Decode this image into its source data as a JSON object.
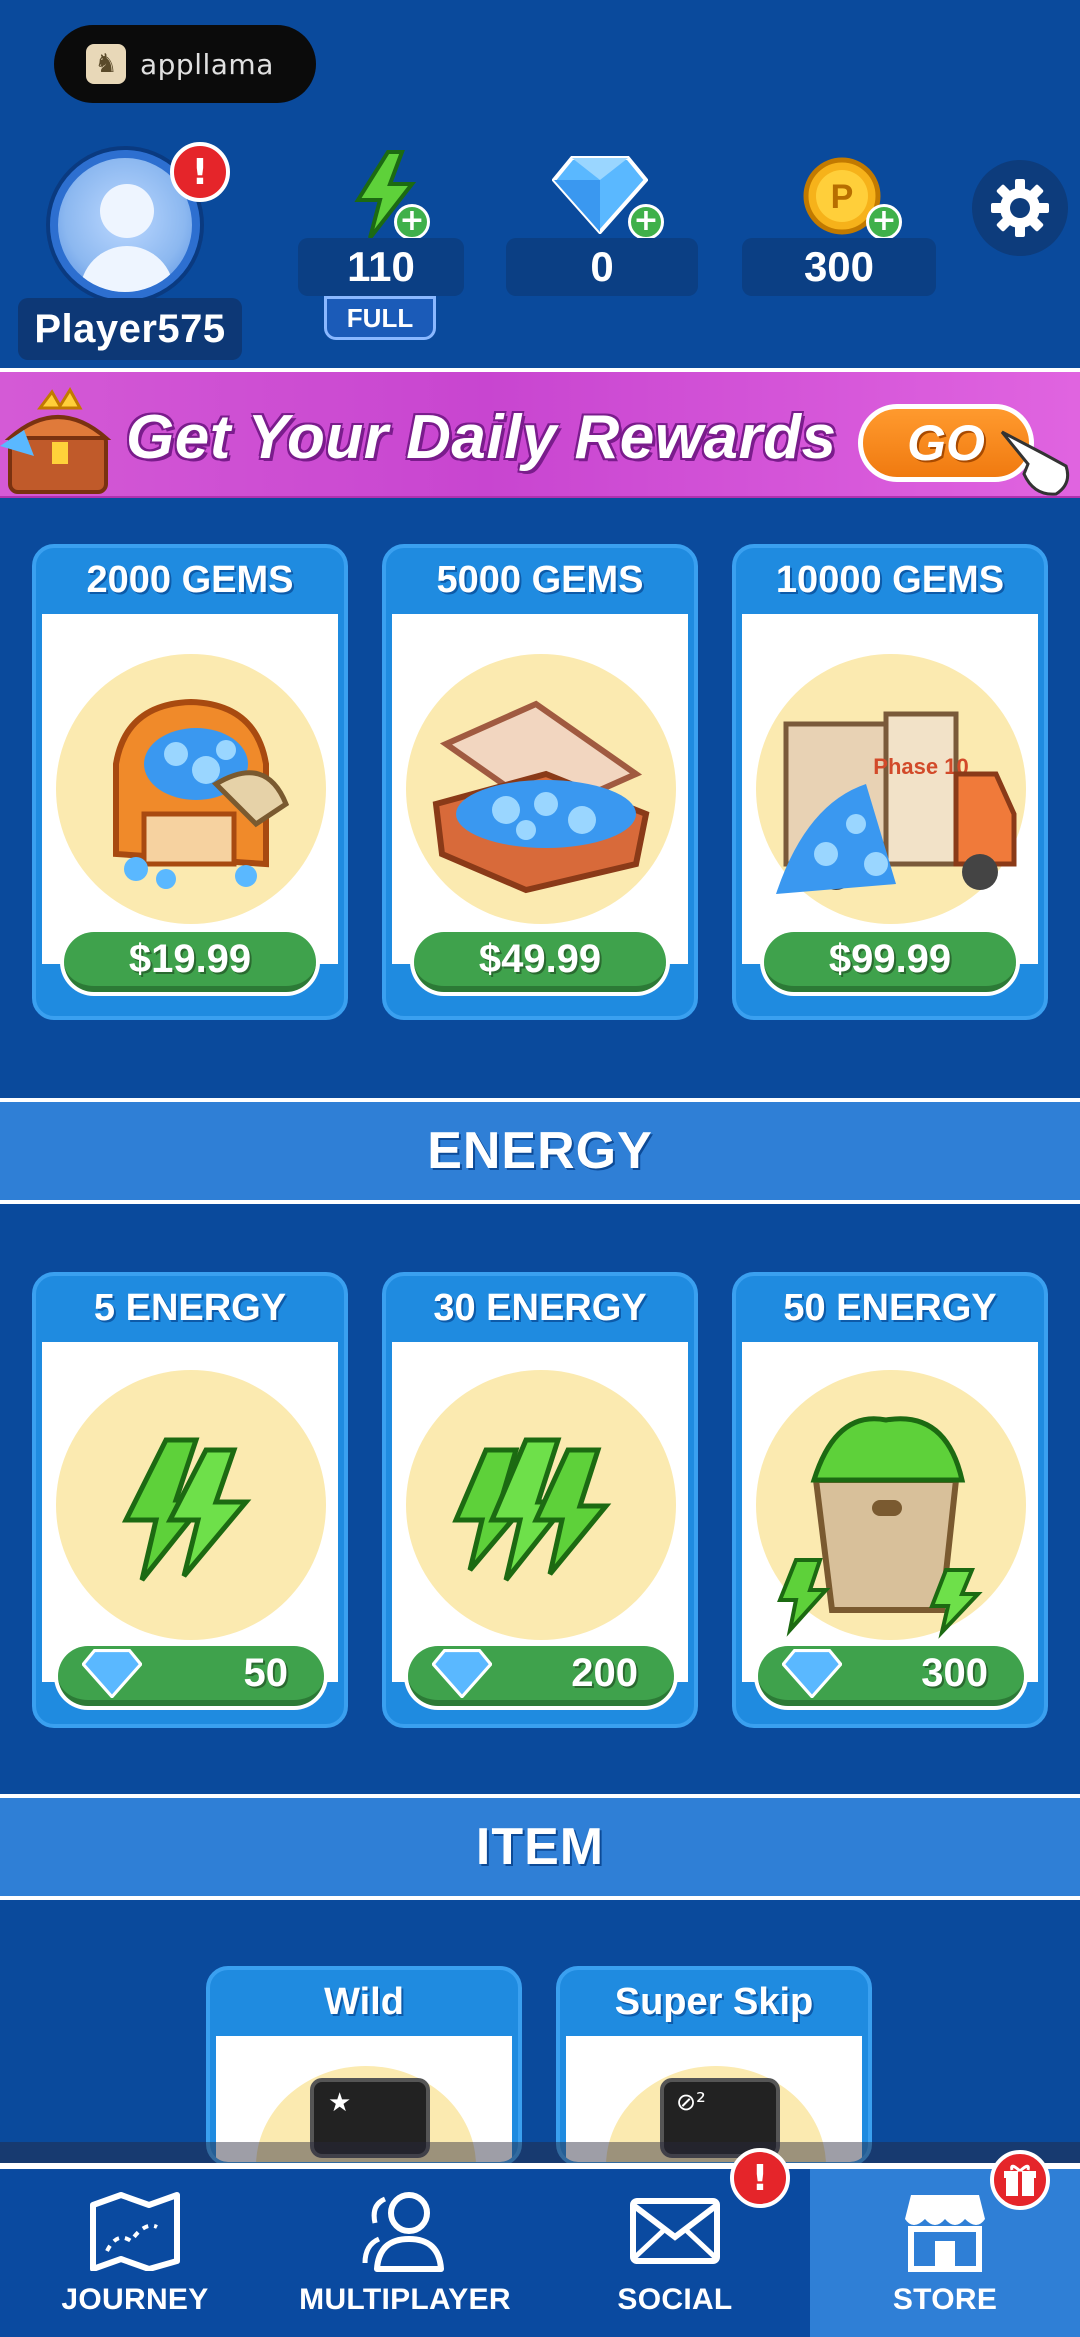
{
  "brand": {
    "name": "appllama"
  },
  "player": {
    "name": "Player575",
    "alert": "!"
  },
  "resources": {
    "energy": {
      "value": "110",
      "status": "FULL"
    },
    "gems": {
      "value": "0"
    },
    "coins": {
      "value": "300",
      "symbol": "P"
    }
  },
  "banner": {
    "text": "Get Your Daily Rewards",
    "button": "GO"
  },
  "gem_packs": [
    {
      "title": "2000 GEMS",
      "price": "$19.99"
    },
    {
      "title": "5000 GEMS",
      "price": "$49.99"
    },
    {
      "title": "10000 GEMS",
      "price": "$99.99",
      "art_label": "Phase 10"
    }
  ],
  "energy_section": {
    "title": "ENERGY"
  },
  "energy_packs": [
    {
      "title": "5 ENERGY",
      "cost": "50"
    },
    {
      "title": "30 ENERGY",
      "cost": "200"
    },
    {
      "title": "50 ENERGY",
      "cost": "300"
    }
  ],
  "item_section": {
    "title": "ITEM"
  },
  "items": [
    {
      "title": "Wild"
    },
    {
      "title": "Super Skip"
    }
  ],
  "nav": {
    "items": [
      {
        "label": "JOURNEY",
        "icon": "map-icon"
      },
      {
        "label": "MULTIPLAYER",
        "icon": "users-icon"
      },
      {
        "label": "SOCIAL",
        "icon": "mail-icon",
        "alert": "!"
      },
      {
        "label": "STORE",
        "icon": "store-icon",
        "active": true
      }
    ]
  },
  "colors": {
    "background": "#0a4a9c",
    "accent": "#2f7fd6",
    "price_green": "#3fa24c",
    "alert_red": "#e5252a"
  }
}
